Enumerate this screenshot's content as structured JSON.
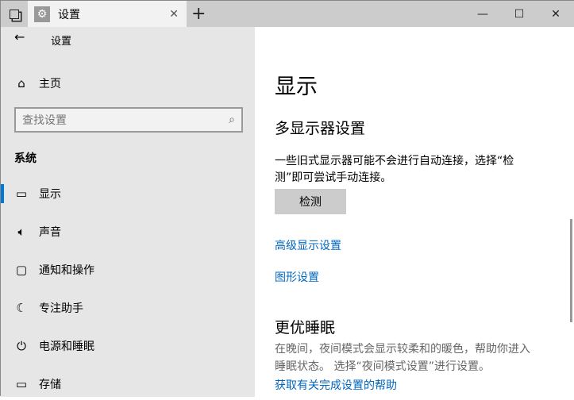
{
  "window": {
    "tab_title": "设置",
    "controls": {
      "minimize": "—",
      "maximize": "☐",
      "close": "✕"
    }
  },
  "sidebar": {
    "back_title": "设置",
    "home": "主页",
    "search_placeholder": "查找设置",
    "section": "系统",
    "items": [
      {
        "label": "显示",
        "icon": "monitor-icon",
        "selected": true
      },
      {
        "label": "声音",
        "icon": "speaker-icon"
      },
      {
        "label": "通知和操作",
        "icon": "notification-icon"
      },
      {
        "label": "专注助手",
        "icon": "moon-icon"
      },
      {
        "label": "电源和睡眠",
        "icon": "power-icon"
      },
      {
        "label": "存储",
        "icon": "storage-icon"
      }
    ]
  },
  "main": {
    "title": "显示",
    "multi_heading": "多显示器设置",
    "multi_desc_1": "一些旧式显示器可能不会进行自动连接，选择“检",
    "multi_desc_2": "测”即可尝试手动连接。",
    "detect_button": "检测",
    "advanced_link": "高级显示设置",
    "graphics_link": "图形设置",
    "sleep_heading": "更优睡眠",
    "sleep_desc_1": "在晚间，夜间模式会显示较柔和的暖色，帮助你进入",
    "sleep_desc_2": "睡眠状态。 选择“夜间模式设置”进行设置。",
    "help_link": "获取有关完成设置的帮助"
  },
  "colors": {
    "accent": "#0078d7",
    "link": "#0067c0"
  }
}
